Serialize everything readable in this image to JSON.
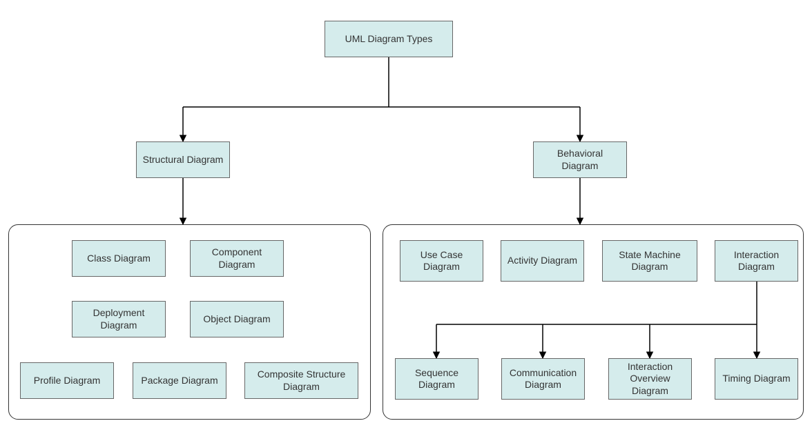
{
  "colors": {
    "nodeFill": "#d5ecec",
    "nodeBorder": "#666666",
    "line": "#000000"
  },
  "nodes": {
    "root": "UML Diagram Types",
    "structural": "Structural Diagram",
    "behavioral": "Behavioral Diagram",
    "class": "Class Diagram",
    "component": "Component Diagram",
    "deployment": "Deployment Diagram",
    "object": "Object Diagram",
    "profile": "Profile Diagram",
    "package": "Package Diagram",
    "composite": "Composite Structure Diagram",
    "usecase": "Use Case Diagram",
    "activity": "Activity Diagram",
    "statemachine": "State Machine Diagram",
    "interaction": "Interaction Diagram",
    "sequence": "Sequence Diagram",
    "communication": "Communication Diagram",
    "interactionOverview": "Interaction Overview Diagram",
    "timing": "Timing Diagram"
  }
}
